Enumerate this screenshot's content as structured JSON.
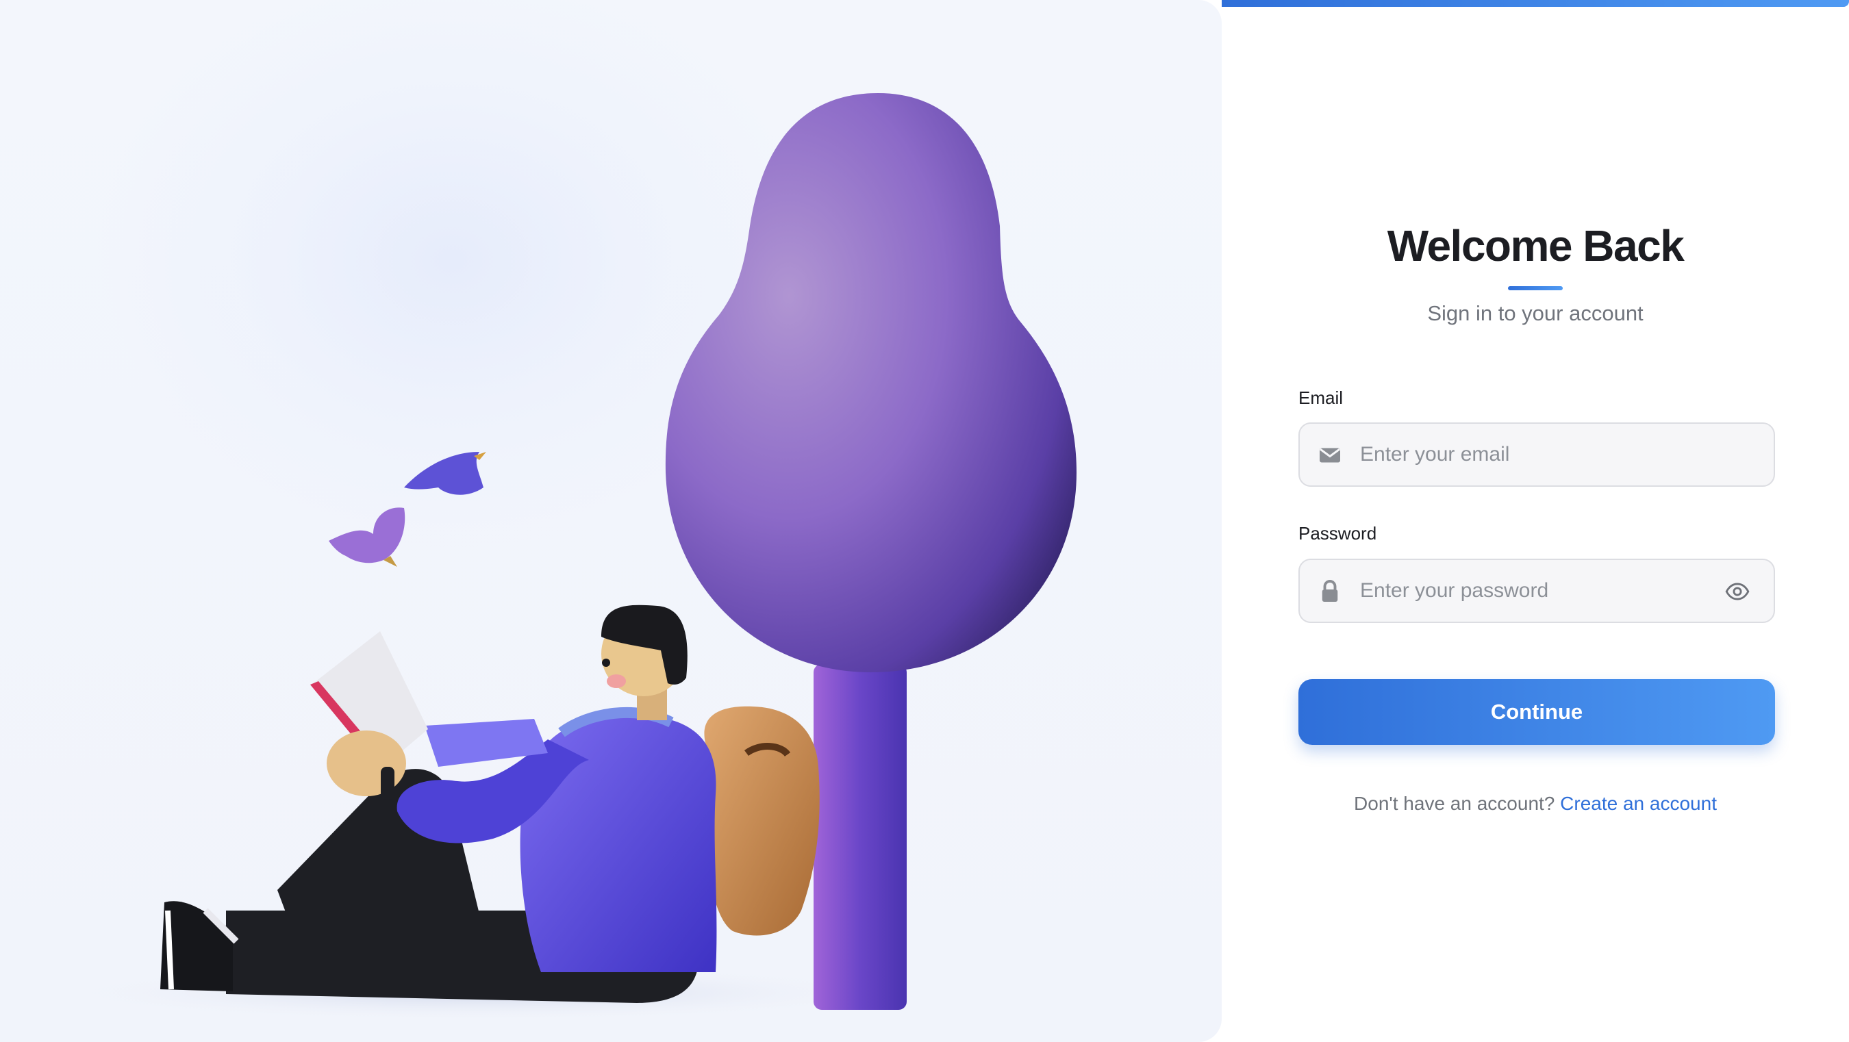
{
  "hero": {
    "illustration_icon": "person-reading-under-tree-illustration",
    "colors": {
      "tree": "#7d5bc6",
      "shirt": "#5646d8",
      "backpack": "#c98a4e",
      "pants": "#1e1f24",
      "bird": "#6a58d9"
    }
  },
  "form": {
    "title": "Welcome Back",
    "subtitle": "Sign in to your account",
    "email": {
      "label": "Email",
      "placeholder": "Enter your email",
      "value": "",
      "icon": "envelope-icon"
    },
    "password": {
      "label": "Password",
      "placeholder": "Enter your password",
      "value": "",
      "icon": "lock-icon",
      "toggle_icon": "eye-icon"
    },
    "continue_label": "Continue",
    "footer_text": "Don't have an account?",
    "footer_link": "Create an account"
  },
  "colors": {
    "accent": "#2f6fd9",
    "accent_light": "#4f9af3",
    "text_dark": "#1c1d22",
    "text_muted": "#70747c",
    "field_bg": "#f6f6f8",
    "field_border": "#dcdde2"
  }
}
